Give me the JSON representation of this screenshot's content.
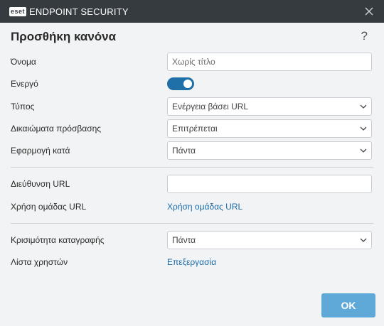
{
  "titlebar": {
    "brand": "eset",
    "product": "ENDPOINT SECURITY",
    "close_icon": "close-icon"
  },
  "dialog": {
    "title": "Προσθήκη κανόνα",
    "help": "?"
  },
  "fields": {
    "name": {
      "label": "Όνομα",
      "placeholder": "Χωρίς τίτλο",
      "value": ""
    },
    "active": {
      "label": "Ενεργό",
      "checked": true
    },
    "type": {
      "label": "Τύπος",
      "value": "Ενέργεια βάσει URL"
    },
    "access": {
      "label": "Δικαιώματα πρόσβασης",
      "value": "Επιτρέπεται"
    },
    "apply": {
      "label": "Εφαρμογή κατά",
      "value": "Πάντα"
    },
    "url": {
      "label": "Διεύθυνση URL",
      "value": ""
    },
    "url_group": {
      "label": "Χρήση ομάδας URL",
      "link": "Χρήση ομάδας URL"
    },
    "severity": {
      "label": "Κρισιμότητα καταγραφής",
      "value": "Πάντα"
    },
    "users": {
      "label": "Λίστα χρηστών",
      "link": "Επεξεργασία"
    }
  },
  "footer": {
    "ok_label": "OK"
  },
  "colors": {
    "titlebar": "#363b40",
    "accent": "#1f6fa8",
    "ok_button": "#5fa9d8",
    "link": "#1a6aa8"
  }
}
